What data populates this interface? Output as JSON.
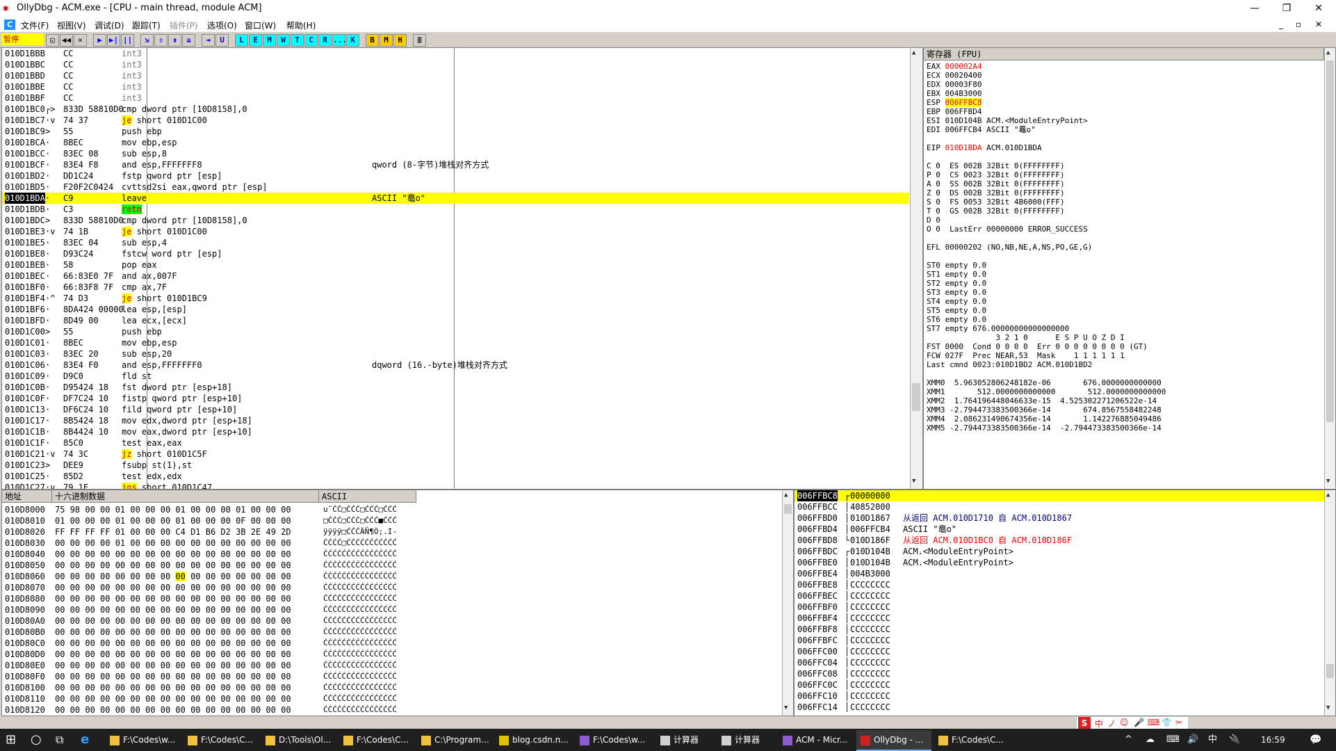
{
  "window": {
    "title": "OllyDbg - ACM.exe - [CPU - main thread, module ACM]",
    "min": "—",
    "max": "❐",
    "close": "✕",
    "inner_min": "_",
    "inner_max": "▫",
    "inner_close": "✕"
  },
  "menu": [
    "文件(F)",
    "视图(V)",
    "调试(D)",
    "跟踪(T)",
    "插件(P)",
    "选项(O)",
    "窗口(W)",
    "帮助(H)"
  ],
  "toolbar": {
    "status": "暂停",
    "buttons": [
      "◱",
      "◀◀",
      "✕",
      "▶",
      "▶|",
      "||",
      "⇲",
      "⇳",
      "⇟",
      "⇊",
      "⇥",
      "U",
      "L",
      "E",
      "M",
      "W",
      "T",
      "C",
      "R",
      "...",
      "K",
      "B",
      "M",
      "H",
      "≣"
    ]
  },
  "disasm": [
    {
      "addr": "010D1BBB",
      "mark": "",
      "hex": "CC",
      "asm": "int3",
      "cmt": ""
    },
    {
      "addr": "010D1BBC",
      "mark": "",
      "hex": "CC",
      "asm": "int3",
      "cmt": ""
    },
    {
      "addr": "010D1BBD",
      "mark": "",
      "hex": "CC",
      "asm": "int3",
      "cmt": ""
    },
    {
      "addr": "010D1BBE",
      "mark": "",
      "hex": "CC",
      "asm": "int3",
      "cmt": ""
    },
    {
      "addr": "010D1BBF",
      "mark": "",
      "hex": "CC",
      "asm": "int3",
      "cmt": ""
    },
    {
      "addr": "010D1BC0",
      "mark": "┌>",
      "hex": "833D 58810D0",
      "asm": "cmp dword ptr [10D8158],0",
      "cmt": ""
    },
    {
      "addr": "010D1BC7",
      "mark": "·v",
      "hex": "74 37",
      "asm": "je short 010D1C00",
      "cmt": "",
      "jmp": "je"
    },
    {
      "addr": "010D1BC9",
      "mark": ">",
      "hex": "55",
      "asm": "push ebp",
      "cmt": ""
    },
    {
      "addr": "010D1BCA",
      "mark": "·",
      "hex": "8BEC",
      "asm": "mov ebp,esp",
      "cmt": ""
    },
    {
      "addr": "010D1BCC",
      "mark": "·",
      "hex": "83EC 08",
      "asm": "sub esp,8",
      "cmt": ""
    },
    {
      "addr": "010D1BCF",
      "mark": "·",
      "hex": "83E4 F8",
      "asm": "and esp,FFFFFFF8",
      "cmt": "qword (8-字节)堆栈对齐方式"
    },
    {
      "addr": "010D1BD2",
      "mark": "·",
      "hex": "DD1C24",
      "asm": "fstp qword ptr [esp]",
      "cmt": ""
    },
    {
      "addr": "010D1BD5",
      "mark": "·",
      "hex": "F20F2C0424",
      "asm": "cvttsd2si eax,qword ptr [esp]",
      "cmt": ""
    },
    {
      "addr": "010D1BDA",
      "mark": "·",
      "hex": "C9",
      "asm": "leave",
      "cmt": "ASCII \"鼁o\"",
      "cur": true
    },
    {
      "addr": "010D1BDB",
      "mark": "·",
      "hex": "C3",
      "asm": "retn",
      "cmt": "",
      "ret": true
    },
    {
      "addr": "010D1BDC",
      "mark": ">",
      "hex": "833D 58810D0",
      "asm": "cmp dword ptr [10D8158],0",
      "cmt": ""
    },
    {
      "addr": "010D1BE3",
      "mark": "·v",
      "hex": "74 1B",
      "asm": "je short 010D1C00",
      "cmt": "",
      "jmp": "je"
    },
    {
      "addr": "010D1BE5",
      "mark": "·",
      "hex": "83EC 04",
      "asm": "sub esp,4",
      "cmt": ""
    },
    {
      "addr": "010D1BE8",
      "mark": "·",
      "hex": "D93C24",
      "asm": "fstcw word ptr [esp]",
      "cmt": ""
    },
    {
      "addr": "010D1BEB",
      "mark": "·",
      "hex": "58",
      "asm": "pop eax",
      "cmt": ""
    },
    {
      "addr": "010D1BEC",
      "mark": "·",
      "hex": "66:83E0 7F",
      "asm": "and ax,007F",
      "cmt": ""
    },
    {
      "addr": "010D1BF0",
      "mark": "·",
      "hex": "66:83F8 7F",
      "asm": "cmp ax,7F",
      "cmt": ""
    },
    {
      "addr": "010D1BF4",
      "mark": "·^",
      "hex": "74 D3",
      "asm": "je short 010D1BC9",
      "cmt": "",
      "jmp": "je"
    },
    {
      "addr": "010D1BF6",
      "mark": "·",
      "hex": "8DA424 00000",
      "asm": "lea esp,[esp]",
      "cmt": ""
    },
    {
      "addr": "010D1BFD",
      "mark": "·",
      "hex": "8D49 00",
      "asm": "lea ecx,[ecx]",
      "cmt": ""
    },
    {
      "addr": "010D1C00",
      "mark": ">",
      "hex": "55",
      "asm": "push ebp",
      "cmt": ""
    },
    {
      "addr": "010D1C01",
      "mark": "·",
      "hex": "8BEC",
      "asm": "mov ebp,esp",
      "cmt": ""
    },
    {
      "addr": "010D1C03",
      "mark": "·",
      "hex": "83EC 20",
      "asm": "sub esp,20",
      "cmt": ""
    },
    {
      "addr": "010D1C06",
      "mark": "·",
      "hex": "83E4 F0",
      "asm": "and esp,FFFFFFF0",
      "cmt": "dqword (16.-byte)堆栈对齐方式"
    },
    {
      "addr": "010D1C09",
      "mark": "·",
      "hex": "D9C0",
      "asm": "fld st",
      "cmt": ""
    },
    {
      "addr": "010D1C0B",
      "mark": "·",
      "hex": "D95424 18",
      "asm": "fst dword ptr [esp+18]",
      "cmt": ""
    },
    {
      "addr": "010D1C0F",
      "mark": "·",
      "hex": "DF7C24 10",
      "asm": "fistp qword ptr [esp+10]",
      "cmt": ""
    },
    {
      "addr": "010D1C13",
      "mark": "·",
      "hex": "DF6C24 10",
      "asm": "fild qword ptr [esp+10]",
      "cmt": ""
    },
    {
      "addr": "010D1C17",
      "mark": "·",
      "hex": "8B5424 18",
      "asm": "mov edx,dword ptr [esp+18]",
      "cmt": ""
    },
    {
      "addr": "010D1C1B",
      "mark": "·",
      "hex": "8B4424 10",
      "asm": "mov eax,dword ptr [esp+10]",
      "cmt": ""
    },
    {
      "addr": "010D1C1F",
      "mark": "·",
      "hex": "85C0",
      "asm": "test eax,eax",
      "cmt": ""
    },
    {
      "addr": "010D1C21",
      "mark": "·v",
      "hex": "74 3C",
      "asm": "jz short 010D1C5F",
      "cmt": "",
      "jmp": "jz"
    },
    {
      "addr": "010D1C23",
      "mark": ">",
      "hex": "DEE9",
      "asm": "fsubp st(1),st",
      "cmt": ""
    },
    {
      "addr": "010D1C25",
      "mark": "·",
      "hex": "85D2",
      "asm": "test edx,edx",
      "cmt": ""
    },
    {
      "addr": "010D1C27",
      "mark": "·v",
      "hex": "79 1E",
      "asm": "jns short 010D1C47",
      "cmt": "",
      "jmp": "jns"
    }
  ],
  "registers": {
    "header": "寄存器 (FPU)",
    "lines": [
      {
        "t": "EAX ",
        "v": "000002A4",
        "rest": "",
        "vc": "red"
      },
      {
        "t": "ECX ",
        "v": "00020400",
        "rest": ""
      },
      {
        "t": "EDX ",
        "v": "00003F80",
        "rest": ""
      },
      {
        "t": "EBX ",
        "v": "004B3000",
        "rest": ""
      },
      {
        "t": "ESP ",
        "v": "006FFBC8",
        "rest": "",
        "vc": "redhl"
      },
      {
        "t": "EBP ",
        "v": "006FFBD4",
        "rest": ""
      },
      {
        "t": "ESI ",
        "v": "010D104B",
        "rest": " ACM.<ModuleEntryPoint>"
      },
      {
        "t": "EDI ",
        "v": "006FFCB4",
        "rest": " ASCII \"鼁o\""
      },
      {
        "t": "",
        "v": "",
        "rest": ""
      },
      {
        "t": "EIP ",
        "v": "010D1BDA",
        "rest": " ACM.010D1BDA",
        "vc": "red"
      },
      {
        "t": "",
        "v": "",
        "rest": ""
      },
      {
        "t": "C 0  ES 002B 32Bit 0(FFFFFFFF)",
        "v": "",
        "rest": ""
      },
      {
        "t": "P 0  CS 0023 32Bit 0(FFFFFFFF)",
        "v": "",
        "rest": ""
      },
      {
        "t": "A 0  SS 002B 32Bit 0(FFFFFFFF)",
        "v": "",
        "rest": ""
      },
      {
        "t": "Z 0  DS 002B 32Bit 0(FFFFFFFF)",
        "v": "",
        "rest": ""
      },
      {
        "t": "S 0  FS 0053 32Bit 4B6000(FFF)",
        "v": "",
        "rest": ""
      },
      {
        "t": "T 0  GS 002B 32Bit 0(FFFFFFFF)",
        "v": "",
        "rest": ""
      },
      {
        "t": "D 0",
        "v": "",
        "rest": ""
      },
      {
        "t": "O 0  LastErr 00000000 ERROR_SUCCESS",
        "v": "",
        "rest": ""
      },
      {
        "t": "",
        "v": "",
        "rest": ""
      },
      {
        "t": "EFL 00000202 (NO,NB,NE,A,NS,PO,GE,G)",
        "v": "",
        "rest": ""
      },
      {
        "t": "",
        "v": "",
        "rest": ""
      },
      {
        "t": "ST0 empty 0.0",
        "v": "",
        "rest": ""
      },
      {
        "t": "ST1 empty 0.0",
        "v": "",
        "rest": ""
      },
      {
        "t": "ST2 empty 0.0",
        "v": "",
        "rest": ""
      },
      {
        "t": "ST3 empty 0.0",
        "v": "",
        "rest": ""
      },
      {
        "t": "ST4 empty 0.0",
        "v": "",
        "rest": ""
      },
      {
        "t": "ST5 empty 0.0",
        "v": "",
        "rest": ""
      },
      {
        "t": "ST6 empty 0.0",
        "v": "",
        "rest": ""
      },
      {
        "t": "ST7 empty 676.00000000000000000",
        "v": "",
        "rest": ""
      },
      {
        "t": "               3 2 1 0      E S P U O Z D I",
        "v": "",
        "rest": ""
      },
      {
        "t": "FST 0000  Cond 0 0 0 0  Err 0 0 0 0 0 0 0 0 (GT)",
        "v": "",
        "rest": ""
      },
      {
        "t": "FCW 027F  Prec NEAR,53  Mask    1 1 1 1 1 1",
        "v": "",
        "rest": ""
      },
      {
        "t": "Last cmnd 0023:010D1BD2 ACM.010D1BD2",
        "v": "",
        "rest": ""
      },
      {
        "t": "",
        "v": "",
        "rest": ""
      },
      {
        "t": "XMM0  5.963052806248182e-06       676.0000000000000",
        "v": "",
        "rest": ""
      },
      {
        "t": "XMM1       512.0000000000000       512.0000000000000",
        "v": "",
        "rest": ""
      },
      {
        "t": "XMM2  1.764196448046633e-15  4.525302271206522e-14",
        "v": "",
        "rest": ""
      },
      {
        "t": "XMM3 -2.794473383500366e-14       674.8567558482248",
        "v": "",
        "rest": ""
      },
      {
        "t": "XMM4  2.086231490674356e-14       1.142276885049486",
        "v": "",
        "rest": ""
      },
      {
        "t": "XMM5 -2.794473383500366e-14  -2.794473383500366e-14",
        "v": "",
        "rest": ""
      }
    ]
  },
  "dump": {
    "h_addr": "地址",
    "h_hex": "十六进制数据",
    "h_ascii": "ASCII",
    "rows": [
      {
        "a": "010D8000",
        "h": "75 98 00 00 01 00 00 00 01 00 00 00 01 00 00 00",
        "s": "u˜ĆĆ□ĆĆĆ□ĆĆĆ□ĆĆĆ"
      },
      {
        "a": "010D8010",
        "h": "01 00 00 00 01 00 00 00 01 00 00 00 0F 00 00 00",
        "s": "□ĆĆĆ□ĆĆĆ□ĆĆĆ■ĆĆĆ"
      },
      {
        "a": "010D8020",
        "h": "FF FF FF FF 01 00 00 00 C4 D1 B6 D2 3B 2E 49 2D",
        "s": "ÿÿÿÿ□ĆĆĆÄÑ¶Ò;.I-"
      },
      {
        "a": "010D8030",
        "h": "00 00 00 00 01 00 00 00 00 00 00 00 00 00 00 00",
        "s": "ĆĆĆĆ□ĆĆĆĆĆĆĆĆĆĆĆ"
      },
      {
        "a": "010D8040",
        "h": "00 00 00 00 00 00 00 00 00 00 00 00 00 00 00 00",
        "s": "ĆĆĆĆĆĆĆĆĆĆĆĆĆĆĆĆ"
      },
      {
        "a": "010D8050",
        "h": "00 00 00 00 00 00 00 00 00 00 00 00 00 00 00 00",
        "s": "ĆĆĆĆĆĆĆĆĆĆĆĆĆĆĆĆ"
      },
      {
        "a": "010D8060",
        "h": "00 00 00 00 00 00 00 00 00 00 00 00 00 00 00 00",
        "s": "ĆĆĆĆĆĆĆĆĆĆĆĆĆĆĆĆ",
        "sel": true
      },
      {
        "a": "010D8070",
        "h": "00 00 00 00 00 00 00 00 00 00 00 00 00 00 00 00",
        "s": "ĆĆĆĆĆĆĆĆĆĆĆĆĆĆĆĆ"
      },
      {
        "a": "010D8080",
        "h": "00 00 00 00 00 00 00 00 00 00 00 00 00 00 00 00",
        "s": "ĆĆĆĆĆĆĆĆĆĆĆĆĆĆĆĆ"
      },
      {
        "a": "010D8090",
        "h": "00 00 00 00 00 00 00 00 00 00 00 00 00 00 00 00",
        "s": "ĆĆĆĆĆĆĆĆĆĆĆĆĆĆĆĆ"
      },
      {
        "a": "010D80A0",
        "h": "00 00 00 00 00 00 00 00 00 00 00 00 00 00 00 00",
        "s": "ĆĆĆĆĆĆĆĆĆĆĆĆĆĆĆĆ"
      },
      {
        "a": "010D80B0",
        "h": "00 00 00 00 00 00 00 00 00 00 00 00 00 00 00 00",
        "s": "ĆĆĆĆĆĆĆĆĆĆĆĆĆĆĆĆ"
      },
      {
        "a": "010D80C0",
        "h": "00 00 00 00 00 00 00 00 00 00 00 00 00 00 00 00",
        "s": "ĆĆĆĆĆĆĆĆĆĆĆĆĆĆĆĆ"
      },
      {
        "a": "010D80D0",
        "h": "00 00 00 00 00 00 00 00 00 00 00 00 00 00 00 00",
        "s": "ĆĆĆĆĆĆĆĆĆĆĆĆĆĆĆĆ"
      },
      {
        "a": "010D80E0",
        "h": "00 00 00 00 00 00 00 00 00 00 00 00 00 00 00 00",
        "s": "ĆĆĆĆĆĆĆĆĆĆĆĆĆĆĆĆ"
      },
      {
        "a": "010D80F0",
        "h": "00 00 00 00 00 00 00 00 00 00 00 00 00 00 00 00",
        "s": "ĆĆĆĆĆĆĆĆĆĆĆĆĆĆĆĆ"
      },
      {
        "a": "010D8100",
        "h": "00 00 00 00 00 00 00 00 00 00 00 00 00 00 00 00",
        "s": "ĆĆĆĆĆĆĆĆĆĆĆĆĆĆĆĆ"
      },
      {
        "a": "010D8110",
        "h": "00 00 00 00 00 00 00 00 00 00 00 00 00 00 00 00",
        "s": "ĆĆĆĆĆĆĆĆĆĆĆĆĆĆĆĆ"
      },
      {
        "a": "010D8120",
        "h": "00 00 00 00 00 00 00 00 00 00 00 00 00 00 00 00",
        "s": "ĆĆĆĆĆĆĆĆĆĆĆĆĆĆĆĆ"
      }
    ]
  },
  "stack": [
    {
      "a": "006FFBC8",
      "m": "┌",
      "v": "00000000",
      "c": "",
      "top": true
    },
    {
      "a": "006FFBCC",
      "m": "│",
      "v": "40852000",
      "c": ""
    },
    {
      "a": "006FFBD0",
      "m": "│",
      "v": "010D1867",
      "c": "从返回 ACM.010D1710 自 ACM.010D1867",
      "cc": "blu"
    },
    {
      "a": "006FFBD4",
      "m": "│",
      "v": "006FFCB4",
      "c": "ASCII \"鼁o\""
    },
    {
      "a": "006FFBD8",
      "m": "└",
      "v": "010D186F",
      "c": "从返回 ACM.010D1BC0 自 ACM.010D186F",
      "cc": "red"
    },
    {
      "a": "006FFBDC",
      "m": "┌",
      "v": "010D104B",
      "c": "ACM.<ModuleEntryPoint>"
    },
    {
      "a": "006FFBE0",
      "m": "│",
      "v": "010D104B",
      "c": "ACM.<ModuleEntryPoint>"
    },
    {
      "a": "006FFBE4",
      "m": "│",
      "v": "004B3000",
      "c": ""
    },
    {
      "a": "006FFBE8",
      "m": "│",
      "v": "CCCCCCCC",
      "c": ""
    },
    {
      "a": "006FFBEC",
      "m": "│",
      "v": "CCCCCCCC",
      "c": ""
    },
    {
      "a": "006FFBF0",
      "m": "│",
      "v": "CCCCCCCC",
      "c": ""
    },
    {
      "a": "006FFBF4",
      "m": "│",
      "v": "CCCCCCCC",
      "c": ""
    },
    {
      "a": "006FFBF8",
      "m": "│",
      "v": "CCCCCCCC",
      "c": ""
    },
    {
      "a": "006FFBFC",
      "m": "│",
      "v": "CCCCCCCC",
      "c": ""
    },
    {
      "a": "006FFC00",
      "m": "│",
      "v": "CCCCCCCC",
      "c": ""
    },
    {
      "a": "006FFC04",
      "m": "│",
      "v": "CCCCCCCC",
      "c": ""
    },
    {
      "a": "006FFC08",
      "m": "│",
      "v": "CCCCCCCC",
      "c": ""
    },
    {
      "a": "006FFC0C",
      "m": "│",
      "v": "CCCCCCCC",
      "c": ""
    },
    {
      "a": "006FFC10",
      "m": "│",
      "v": "CCCCCCCC",
      "c": ""
    },
    {
      "a": "006FFC14",
      "m": "│",
      "v": "CCCCCCCC",
      "c": ""
    }
  ],
  "ime": {
    "logo": "S",
    "chars": [
      "中",
      "ノ",
      "☺",
      "🎤",
      "⌨",
      "👕",
      "✂"
    ]
  },
  "taskbar": {
    "start": "⊞",
    "search": "○",
    "taskview": "⧉",
    "items": [
      {
        "label": "F:\\Codes\\w...",
        "icon": "folder"
      },
      {
        "label": "F:\\Codes\\C...",
        "icon": "folder"
      },
      {
        "label": "D:\\Tools\\Ol...",
        "icon": "folder"
      },
      {
        "label": "F:\\Codes\\C...",
        "icon": "folder"
      },
      {
        "label": "C:\\Program...",
        "icon": "folder"
      },
      {
        "label": "blog.csdn.n...",
        "icon": "chrome"
      },
      {
        "label": "F:\\Codes\\w...",
        "icon": "vs"
      },
      {
        "label": "计算器",
        "icon": "calc"
      },
      {
        "label": "计算器",
        "icon": "calc"
      },
      {
        "label": "ACM - Micr...",
        "icon": "vs"
      },
      {
        "label": "OllyDbg - ...",
        "icon": "olly",
        "active": true
      },
      {
        "label": "F:\\Codes\\C...",
        "icon": "folder"
      }
    ],
    "tray": [
      "^",
      "☁",
      "⌨",
      "🔊",
      "中",
      "🔌"
    ],
    "clock": "16:59",
    "notify": "💬"
  },
  "colors": {
    "accent": "#ffff00",
    "current": "#000000",
    "error": "#ff0000",
    "taskbar": "#1f1f1f"
  }
}
